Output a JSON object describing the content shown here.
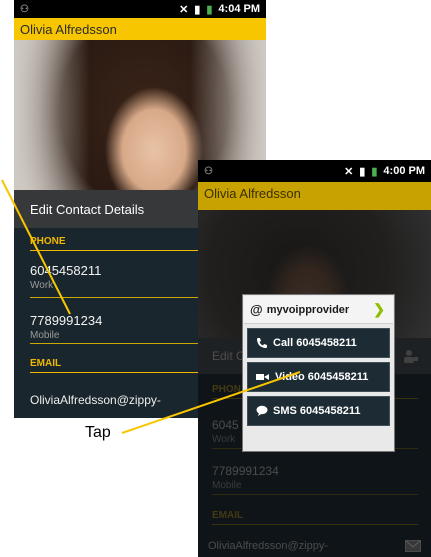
{
  "phone_back": {
    "status_time": "4:04 PM",
    "contact_name": "Olivia Alfredsson",
    "edit_label": "Edit Contact Details",
    "phone_section": "PHONE",
    "phones": [
      {
        "number": "6045458211",
        "label": "Work"
      },
      {
        "number": "7789991234",
        "label": "Mobile"
      }
    ],
    "email_section": "EMAIL",
    "email": "OliviaAlfredsson@zippy-"
  },
  "phone_front": {
    "status_time": "4:00 PM",
    "contact_name": "Olivia Alfredsson",
    "edit_label": "Edit C",
    "phone_section": "PHON",
    "phones": [
      {
        "number": "6045",
        "label": "Work"
      },
      {
        "number": "7789991234",
        "label": "Mobile"
      }
    ],
    "email_section": "EMAIL",
    "email": "OliviaAlfredsson@zippy-",
    "popup": {
      "provider": "myvoipprovider",
      "call": "Call 6045458211",
      "video": "Video 6045458211",
      "sms": "SMS 6045458211"
    }
  },
  "annotation": {
    "tap_label": "Tap",
    "line_color": "#f7c600"
  },
  "colors": {
    "accent": "#f7c600",
    "background_dark": "#1a262d",
    "chevron": "#8fbf00"
  }
}
